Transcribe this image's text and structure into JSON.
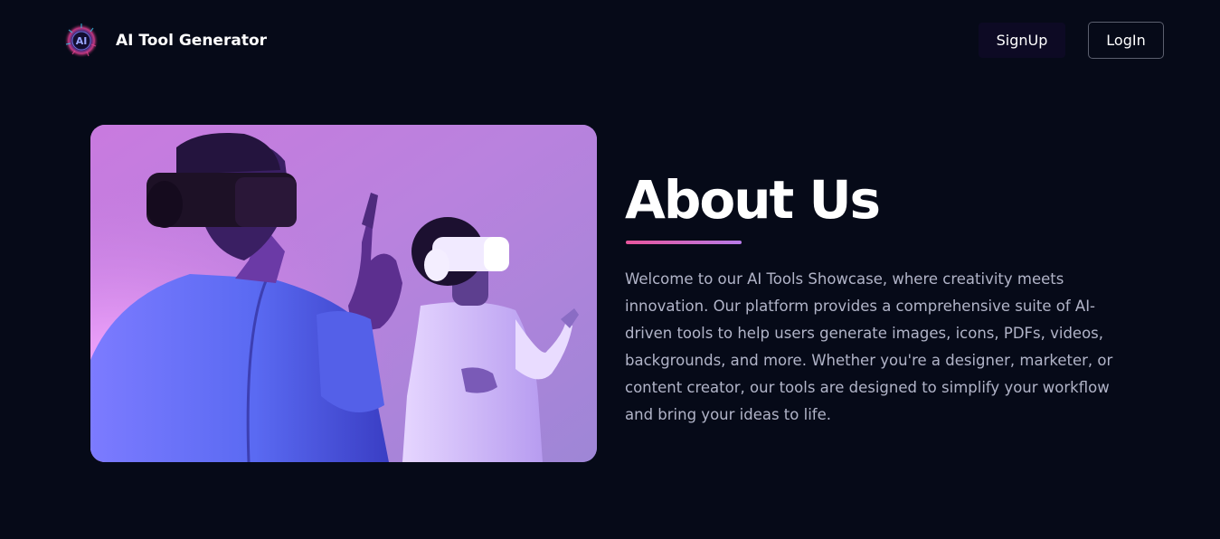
{
  "header": {
    "brand_name": "AI Tool Generator",
    "logo_text": "AI",
    "signup_label": "SignUp",
    "login_label": "LogIn"
  },
  "about": {
    "title": "About Us",
    "body": "Welcome to our AI Tools Showcase, where creativity meets innovation. Our platform provides a comprehensive suite of AI-driven tools to help users generate images, icons, PDFs, videos, backgrounds, and more. Whether you're a designer, marketer, or content creator, our tools are designed to simplify your workflow and bring your ideas to life."
  },
  "colors": {
    "background": "#060a18",
    "accent_start": "#e8559c",
    "accent_end": "#b77be8",
    "body_text": "#b1b4c8"
  }
}
